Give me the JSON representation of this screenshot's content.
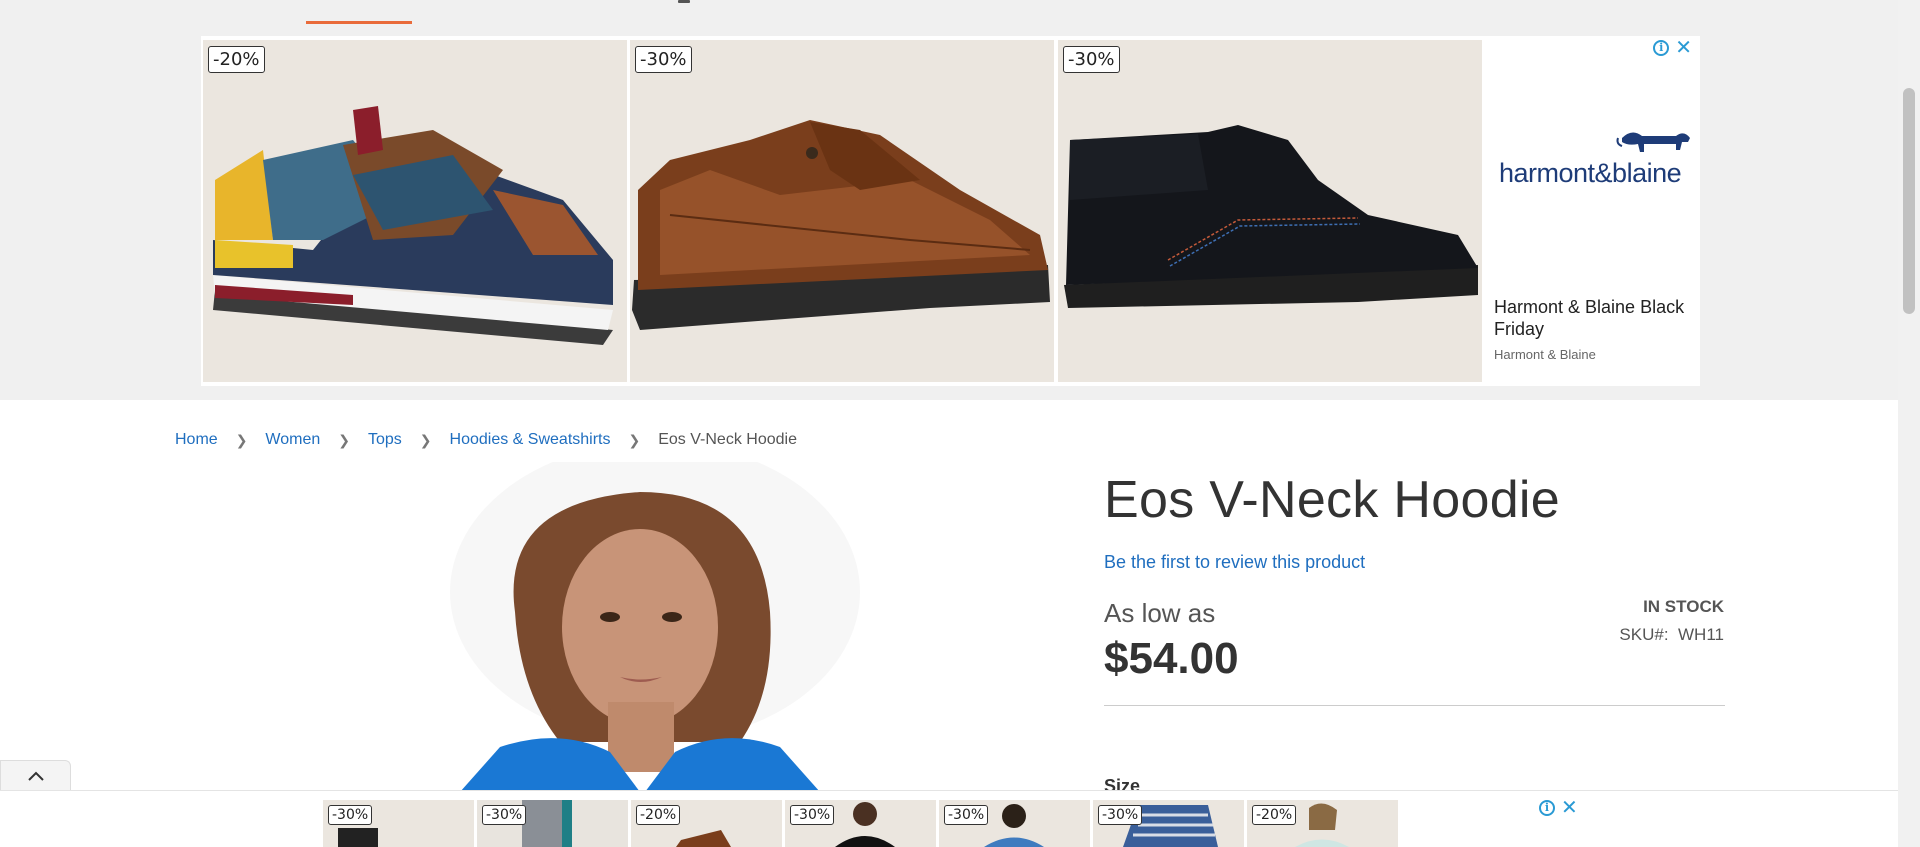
{
  "top_ad": {
    "cards": [
      {
        "discount": "-20%"
      },
      {
        "discount": "-30%"
      },
      {
        "discount": "-30%"
      }
    ],
    "brand": {
      "name": "harmont&blaine",
      "headline": "Harmont & Blaine Black Friday",
      "advertiser": "Harmont & Blaine"
    },
    "icons": [
      "info-icon",
      "close-icon"
    ],
    "colors": {
      "brand_navy": "#1e3c78",
      "ad_icon": "#2a9ad4"
    }
  },
  "breadcrumb": {
    "items": [
      "Home",
      "Women",
      "Tops",
      "Hoodies & Sweatshirts"
    ],
    "current": "Eos V-Neck Hoodie"
  },
  "product": {
    "title": "Eos V-Neck Hoodie",
    "review_link": "Be the first to review this product",
    "price_prefix": "As low as",
    "price": "$54.00",
    "stock": "IN STOCK",
    "sku_label": "SKU#:",
    "sku_value": "WH11",
    "size_label": "Size"
  },
  "bottom_ad": {
    "thumbs": [
      "-30%",
      "-30%",
      "-20%",
      "-30%",
      "-30%",
      "-30%",
      "-20%"
    ]
  },
  "colors": {
    "link": "#1f6ebf",
    "accent_underline": "#e96b3a"
  }
}
